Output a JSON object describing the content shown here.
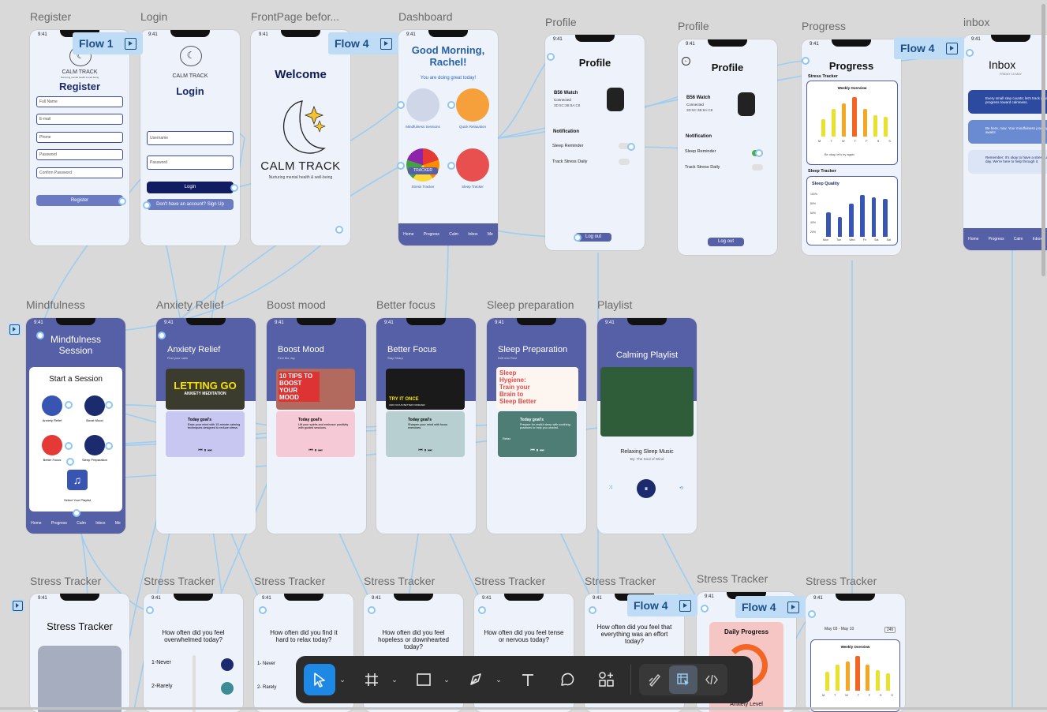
{
  "canvas": {
    "frame_labels": {
      "register": "Register",
      "login": "Login",
      "frontpage": "FrontPage befor...",
      "dashboard": "Dashboard",
      "profile1": "Profile",
      "profile2": "Profile",
      "progress": "Progress",
      "inbox": "inbox",
      "mindfulness": "Mindfulness",
      "anxiety": "Anxiety Relief",
      "boost": "Boost mood",
      "focus": "Better focus",
      "sleep": "Sleep preparation",
      "playlist": "Playlist",
      "stress1": "Stress Tracker",
      "stress2": "Stress Tracker",
      "stress3": "Stress Tracker",
      "stress4": "Stress Tracker",
      "stress5": "Stress Tracker",
      "stress6": "Stress Tracker",
      "stress7": "Stress Tracker",
      "stress8": "Stress Tracker"
    },
    "flows": {
      "flow1": "Flow 1",
      "flow4a": "Flow 4",
      "flow4b": "Flow 4",
      "flow4c": "Flow 4",
      "flow4d": "Flow 4"
    }
  },
  "phone": {
    "time": "9:41"
  },
  "register": {
    "brand": "CALM TRACK",
    "tagline": "Nurturing mental health & well-being",
    "title": "Register",
    "fields": [
      "Full Name",
      "E-mail",
      "Phone",
      "Password",
      "Confirm Password"
    ],
    "button": "Register"
  },
  "login": {
    "brand": "CALM TRACK",
    "title": "Login",
    "username": "Username",
    "password": "Password",
    "button": "Login",
    "signup": "Don't have an account? Sign Up"
  },
  "frontpage": {
    "title": "Welcome",
    "brand": "CALM TRACK",
    "tagline": "Nurturing mental health & well-being"
  },
  "dashboard": {
    "greeting": "Good Morning, Rachel!",
    "sub": "You are doing great today!",
    "tiles": [
      "Mindfulness Sessions",
      "Quick Relaxation",
      "Stress Tracker",
      "Sleep Tracker"
    ],
    "tracker_text": "TRACKER",
    "nav": [
      "Home",
      "Progress",
      "Calm",
      "Inbox",
      "Me"
    ]
  },
  "profile": {
    "title": "Profile",
    "device": "B56 Watch",
    "connected": "Connected",
    "mac": "3D:5C:3B:8A:C8",
    "notification": "Notification",
    "sleep_reminder": "Sleep Reminder",
    "track_stress": "Track Stress Daily",
    "logout": "Log out"
  },
  "progress": {
    "title": "Progress",
    "stress_tracker": "Stress Tracker",
    "weekly": "Weekly Overview",
    "days": [
      "M",
      "T",
      "W",
      "T",
      "F",
      "S",
      "S"
    ],
    "note": "Be okay, let's try again",
    "sleep_tracker": "Sleep Tracker",
    "sleep_quality": "Sleep Quality",
    "yticks": [
      "100%",
      "80%",
      "60%",
      "40%",
      "20%"
    ],
    "sleep_days": [
      "Mon",
      "Tue",
      "Wed",
      "Fri",
      "Sat",
      "Sat"
    ]
  },
  "inbox": {
    "title": "Inbox",
    "date": "FRIDAY 10 MAY",
    "messages": [
      "Every small step counts; let's track your progress toward calmness.",
      "Be here, now. Your mindfulness journey awaits",
      "Remember: It's okay to have a stressful day. We're here to help through it."
    ],
    "nav": [
      "Home",
      "Progress",
      "Calm",
      "Inbox"
    ]
  },
  "mindfulness": {
    "title": "Mindfulness Session",
    "start": "Start a Session",
    "items": [
      "Anxiety Relief",
      "Boost Mood",
      "Better Focus",
      "Sleep Preparation",
      "Select Your Playlist"
    ],
    "nav": [
      "Home",
      "Progress",
      "Calm",
      "Inbox",
      "Me"
    ]
  },
  "sessions": [
    {
      "title": "Anxiety Relief",
      "sub": "Find your calm",
      "banner": "LETTING GO",
      "banner2": "ANXIETY MEDITATION",
      "goal": "Today goal's",
      "desc": "Ease your mind with 15-minute calming techniques designed to reduce stress."
    },
    {
      "title": "Boost Mood",
      "sub": "Feel the Joy",
      "banner": "10 TIPS TO BOOST YOUR MOOD",
      "banner2": "",
      "goal": "Today goal's",
      "desc": "Lift your spirits and embrace positivity with guided sessions."
    },
    {
      "title": "Better Focus",
      "sub": "Stay Sharp",
      "banner": "TRY IT ONCE",
      "banner2": "AND FOCUS BETTER FOREVER",
      "goal": "Today goal's",
      "desc": "Sharpen your mind with focus exercises."
    },
    {
      "title": "Sleep Preparation",
      "sub": "Drift into Rest",
      "banner": "Sleep Hygiene: Train your Brain to Sleep Better",
      "banner2": "",
      "goal": "Today goal's",
      "desc": "Prepare for restful sleep with soothing practices to help you unwind.",
      "tag": "Relax"
    }
  ],
  "playlist": {
    "title": "Calming Playlist",
    "track": "Relaxing Sleep Music",
    "artist": "By: The Soul of Wind"
  },
  "stress": {
    "title": "Stress Tracker",
    "q1": "How often did you feel overwhelmed today?",
    "q2": "How often did you find it hard to relax today?",
    "q3": "How often did you feel hopeless or downhearted today?",
    "q4": "How often did you feel tense or nervous today?",
    "q5": "How often did you feel that everything was an effort today?",
    "opt1": "1-Never",
    "opt2": "2-Rarely",
    "opt1b": "1- Never",
    "opt2b": "2- Rarely",
    "daily_progress": "Daily Progress",
    "anxiety_level": "Anxiety Level",
    "date_range": "May 03 - May 10",
    "range": "24h",
    "weekly": "Weekly Overview"
  },
  "toolbar": {
    "tools": [
      "move-tool",
      "frame-tool",
      "shape-tool",
      "pen-tool",
      "text-tool",
      "comment-tool",
      "actions-tool"
    ],
    "modes": [
      "draw-mode",
      "design-mode",
      "dev-mode"
    ]
  },
  "colors": {
    "canvas": "#d9d9d9",
    "navy": "#1c2a6e",
    "purple": "#5560a6",
    "flow": "#bfdcf7",
    "connector": "#9ccdf3",
    "accent_blue": "#1e88e5"
  }
}
